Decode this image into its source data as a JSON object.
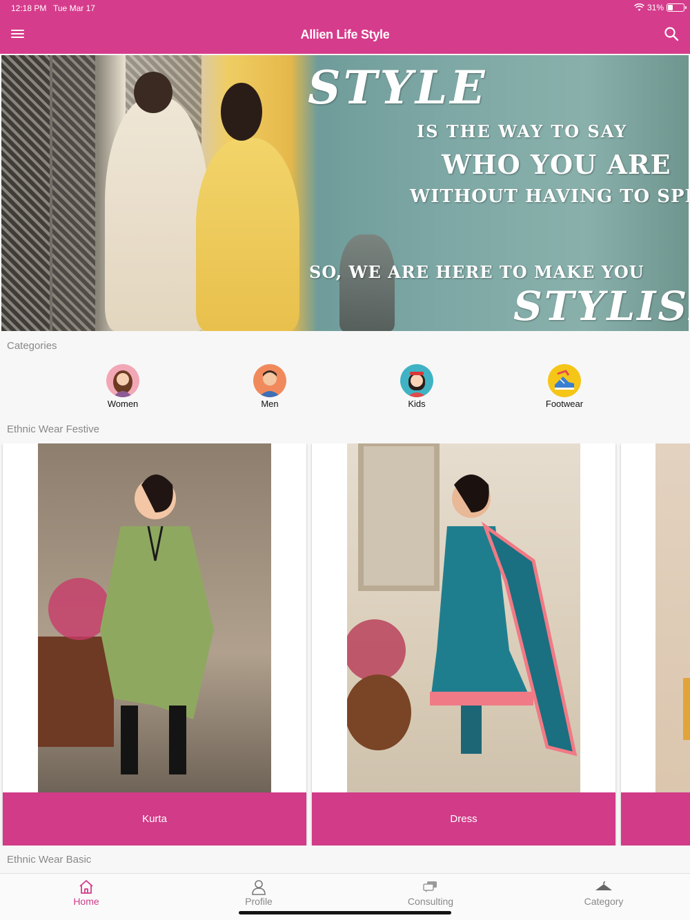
{
  "status_bar": {
    "time": "12:18 PM",
    "date": "Tue Mar 17",
    "battery": "31%",
    "battery_level": 0.31
  },
  "header": {
    "title": "Allien Life Style",
    "menu_icon": "hamburger-menu-icon",
    "search_icon": "search-icon"
  },
  "banner": {
    "lines": [
      "STYLE",
      "IS THE WAY TO SAY",
      "WHO YOU ARE",
      "WITHOUT HAVING TO SPEAK.",
      "SO, WE ARE HERE TO MAKE YOU",
      "STYLISH."
    ]
  },
  "categories": {
    "title": "Categories",
    "items": [
      {
        "label": "Women",
        "icon": "woman-avatar-icon",
        "color": "#f2a7b6"
      },
      {
        "label": "Men",
        "icon": "man-avatar-icon",
        "color": "#f08a5d"
      },
      {
        "label": "Kids",
        "icon": "kid-avatar-icon",
        "color": "#3fb3c4"
      },
      {
        "label": "Footwear",
        "icon": "shoe-icon",
        "color": "#f5c518"
      }
    ]
  },
  "ethnic_festive": {
    "title": "Ethnic Wear Festive",
    "cards": [
      {
        "caption": "Kurta",
        "dress_color": "#8fa860"
      },
      {
        "caption": "Dress",
        "dress_color": "#1f7e8e"
      }
    ]
  },
  "ethnic_basic": {
    "title": "Ethnic Wear Basic"
  },
  "bottom_nav": {
    "items": [
      {
        "label": "Home",
        "icon": "home-icon",
        "active": true
      },
      {
        "label": "Profile",
        "icon": "profile-icon",
        "active": false
      },
      {
        "label": "Consulting",
        "icon": "chat-icon",
        "active": false
      },
      {
        "label": "Category",
        "icon": "hanger-icon",
        "active": false
      }
    ]
  },
  "colors": {
    "accent": "#d63c8c",
    "caption_bg": "#d13b88"
  }
}
